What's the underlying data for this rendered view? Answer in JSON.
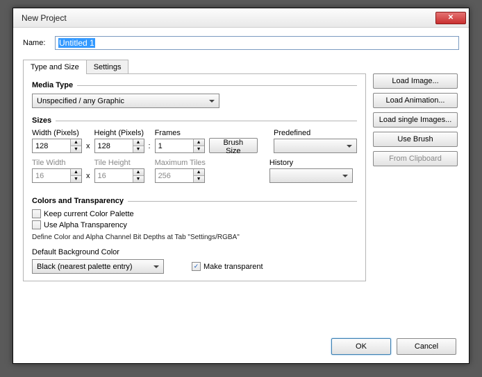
{
  "dialog": {
    "title": "New Project"
  },
  "name": {
    "label": "Name:",
    "value": "Untitled 1"
  },
  "tabs": {
    "type_size": "Type and Size",
    "settings": "Settings"
  },
  "media": {
    "label": "Media Type",
    "value": "Unspecified / any Graphic"
  },
  "sizes": {
    "label": "Sizes",
    "width_label": "Width (Pixels)",
    "width": "128",
    "height_label": "Height (Pixels)",
    "height": "128",
    "frames_label": "Frames",
    "frames": "1",
    "brush_btn": "Brush Size",
    "tile_width_label": "Tile Width",
    "tile_width": "16",
    "tile_height_label": "Tile Height",
    "tile_height": "16",
    "max_tiles_label": "Maximum Tiles",
    "max_tiles": "256",
    "predefined_label": "Predefined",
    "history_label": "History"
  },
  "colors": {
    "label": "Colors and Transparency",
    "keep_palette": "Keep current Color Palette",
    "use_alpha": "Use Alpha Transparency",
    "hint": "Define Color and Alpha Channel Bit Depths at Tab \"Settings/RGBA\"",
    "bg_label": "Default Background Color",
    "bg_value": "Black (nearest palette entry)",
    "make_trans": "Make transparent"
  },
  "side": {
    "load_image": "Load Image...",
    "load_anim": "Load Animation...",
    "load_single": "Load single Images...",
    "use_brush": "Use Brush",
    "from_clip": "From Clipboard"
  },
  "footer": {
    "ok": "OK",
    "cancel": "Cancel"
  }
}
